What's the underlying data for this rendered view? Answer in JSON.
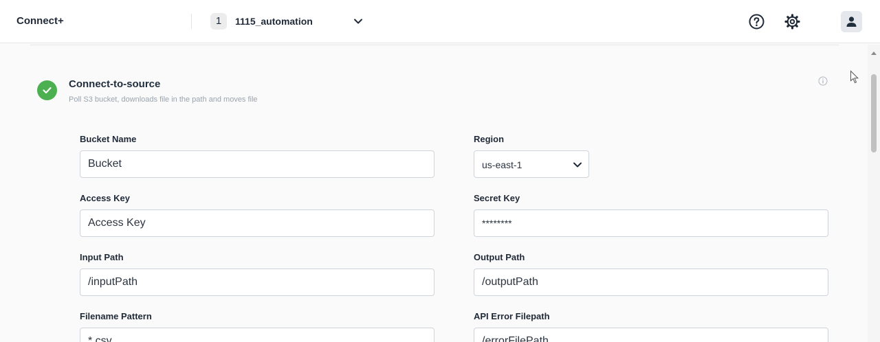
{
  "header": {
    "brand": "Connect+",
    "workflow_number": "1",
    "workflow_name": "1115_automation"
  },
  "step": {
    "title": "Connect-to-source",
    "description": "Poll S3 bucket, downloads file in the path and moves file",
    "status": "complete",
    "status_color": "#4caf50"
  },
  "form": {
    "bucket_name": {
      "label": "Bucket Name",
      "value": "Bucket"
    },
    "region": {
      "label": "Region",
      "value": "us-east-1"
    },
    "access_key": {
      "label": "Access Key",
      "value": "Access Key"
    },
    "secret_key": {
      "label": "Secret Key",
      "value": "********"
    },
    "input_path": {
      "label": "Input Path",
      "value": "/inputPath"
    },
    "output_path": {
      "label": "Output Path",
      "value": "/outputPath"
    },
    "filename_pattern": {
      "label": "Filename Pattern",
      "value": "*.csv"
    },
    "api_error_filepath": {
      "label": "API Error Filepath",
      "value": "/errorFilePath"
    }
  },
  "icons": {
    "help": "help-circle-icon",
    "settings": "gear-icon",
    "account": "user-icon",
    "dropdown": "chevron-down-icon",
    "info": "info-icon",
    "status": "check-icon"
  }
}
